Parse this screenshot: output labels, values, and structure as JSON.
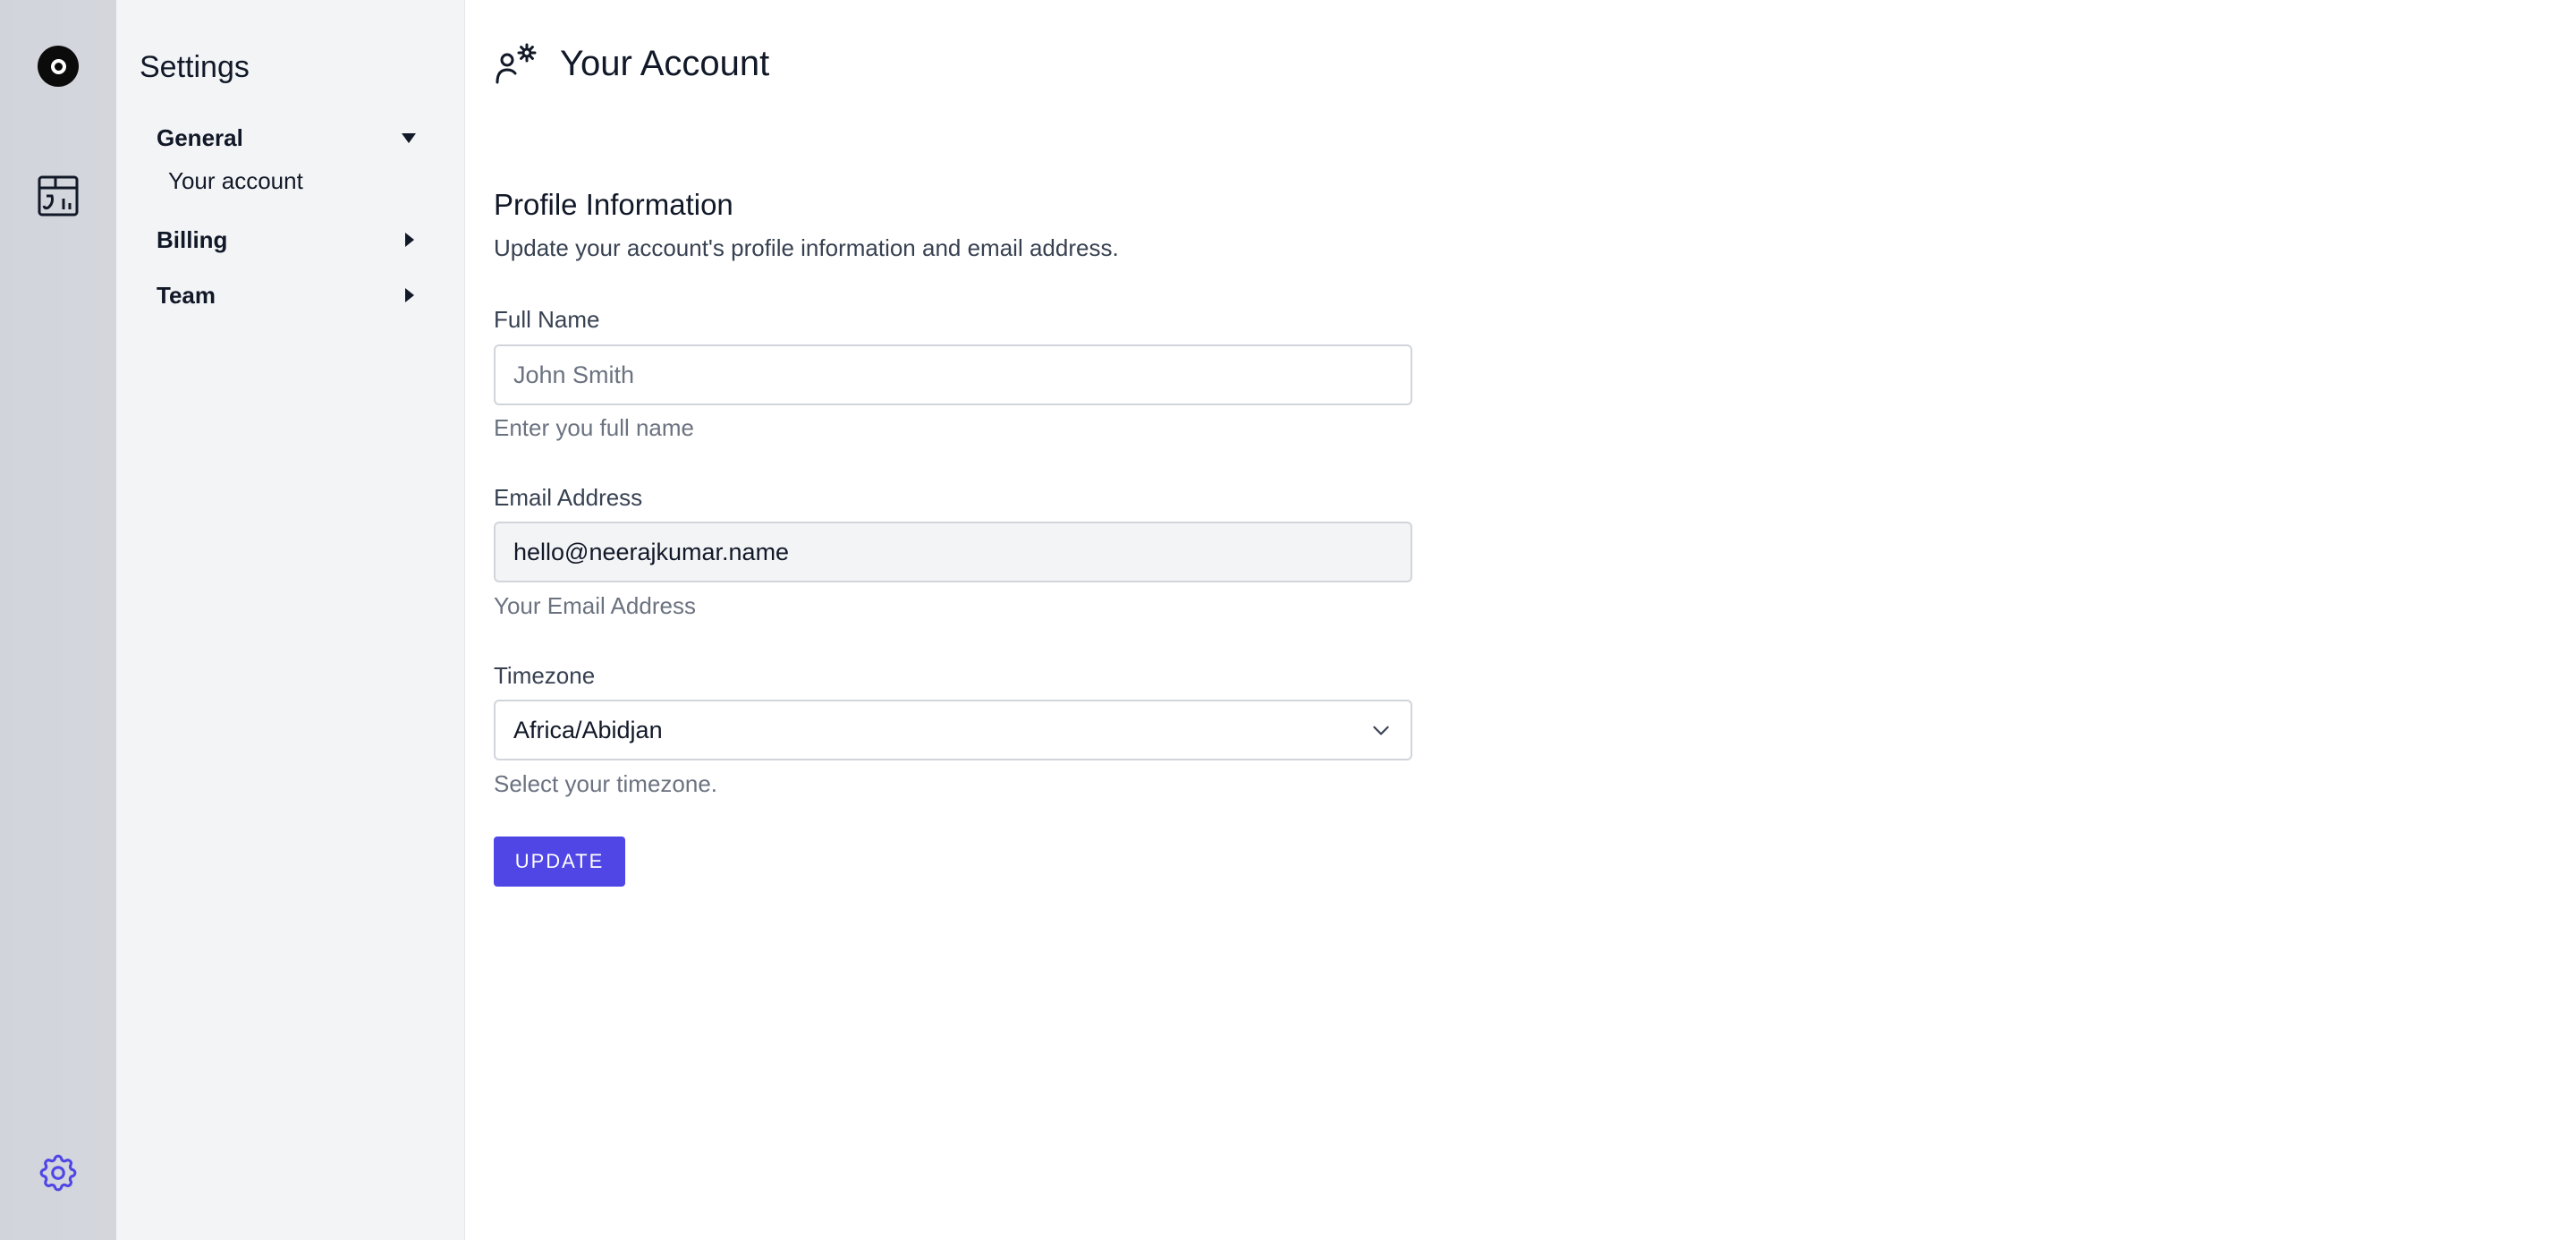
{
  "rail": {
    "icons": [
      "logo-icon",
      "dashboard-icon",
      "settings-gear-icon"
    ],
    "active_color": "#4f46e5"
  },
  "sidebar": {
    "title": "Settings",
    "items": [
      {
        "label": "General",
        "expanded": true,
        "children": [
          {
            "label": "Your account"
          }
        ]
      },
      {
        "label": "Billing",
        "expanded": false
      },
      {
        "label": "Team",
        "expanded": false
      }
    ]
  },
  "header": {
    "title": "Your Account",
    "icon": "user-gear-icon"
  },
  "profile": {
    "title": "Profile Information",
    "description": "Update your account's profile information and email address.",
    "full_name": {
      "label": "Full Name",
      "value": "",
      "placeholder": "John Smith",
      "help": "Enter you full name"
    },
    "email": {
      "label": "Email Address",
      "value": "hello@neerajkumar.name",
      "help": "Your Email Address"
    },
    "timezone": {
      "label": "Timezone",
      "value": "Africa/Abidjan",
      "help": "Select your timezone."
    },
    "update_label": "UPDATE"
  },
  "colors": {
    "accent": "#4f46e5",
    "rail_bg": "#d1d5db",
    "sidebar_bg": "#f3f4f6"
  }
}
